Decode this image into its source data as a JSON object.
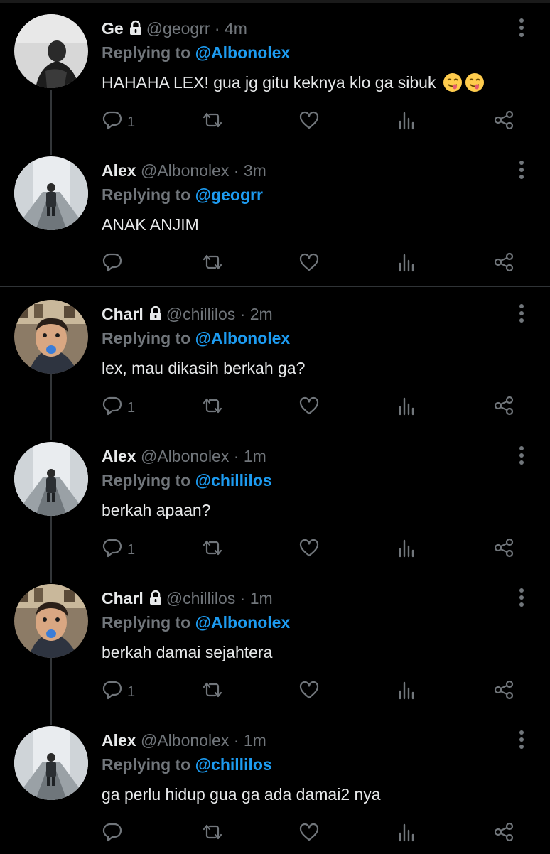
{
  "colors": {
    "background": "#000000",
    "text": "#e7e9ea",
    "muted": "#71767b",
    "mention": "#1d9bf0",
    "thread_line": "#333639"
  },
  "icons": [
    "lock-icon",
    "more-vertical-icon",
    "reply-icon",
    "retweet-icon",
    "like-icon",
    "analytics-icon",
    "share-icon",
    "yum-emoji"
  ],
  "tweets": [
    {
      "name": "Ge",
      "locked": true,
      "handle": "@geogrr",
      "dot": "·",
      "time": "4m",
      "replying_label": "Replying to",
      "mention": "@Albonolex",
      "text": "HAHAHA LEX! gua jg gitu keknya klo ga sibuk",
      "reply_count": "1"
    },
    {
      "name": "Alex",
      "locked": false,
      "handle": "@Albonolex",
      "dot": "·",
      "time": "3m",
      "replying_label": "Replying to",
      "mention": "@geogrr",
      "text": "ANAK ANJIM",
      "reply_count": ""
    },
    {
      "name": "Charl",
      "locked": true,
      "handle": "@chillilos",
      "dot": "·",
      "time": "2m",
      "replying_label": "Replying to",
      "mention": "@Albonolex",
      "text": "lex, mau dikasih berkah ga?",
      "reply_count": "1"
    },
    {
      "name": "Alex",
      "locked": false,
      "handle": "@Albonolex",
      "dot": "·",
      "time": "1m",
      "replying_label": "Replying to",
      "mention": "@chillilos",
      "text": "berkah apaan?",
      "reply_count": "1"
    },
    {
      "name": "Charl",
      "locked": true,
      "handle": "@chillilos",
      "dot": "·",
      "time": "1m",
      "replying_label": "Replying to",
      "mention": "@Albonolex",
      "text": "berkah damai sejahtera",
      "reply_count": "1"
    },
    {
      "name": "Alex",
      "locked": false,
      "handle": "@Albonolex",
      "dot": "·",
      "time": "1m",
      "replying_label": "Replying to",
      "mention": "@chillilos",
      "text": "ga perlu hidup gua ga ada damai2 nya",
      "reply_count": ""
    }
  ]
}
